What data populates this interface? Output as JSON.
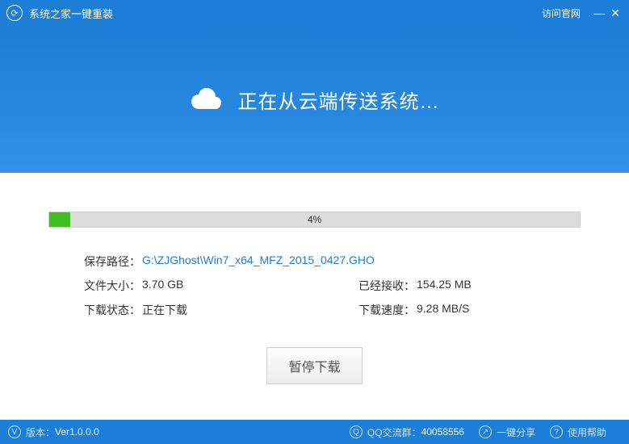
{
  "titlebar": {
    "title": "系统之家一键重装",
    "official_link": "访问官网"
  },
  "hero": {
    "text": "正在从云端传送系统…"
  },
  "progress": {
    "percent": 4,
    "percent_label": "4%"
  },
  "info": {
    "save_path_label": "保存路径：",
    "save_path_value": "G:\\ZJGhost\\Win7_x64_MFZ_2015_0427.GHO",
    "file_size_label": "文件大小：",
    "file_size_value": "3.70 GB",
    "received_label": "已经接收：",
    "received_value": "154.25 MB",
    "status_label": "下载状态：",
    "status_value": "正在下载",
    "speed_label": "下载速度：",
    "speed_value": "9.28 MB/S"
  },
  "buttons": {
    "pause": "暂停下载"
  },
  "footer": {
    "version_label": "版本：",
    "version_value": "Ver1.0.0.0",
    "qq_label": "QQ交流群：",
    "qq_value": "40058556",
    "share": "一键分享",
    "help": "使用帮助"
  },
  "colors": {
    "primary": "#1c7ed6",
    "progress_fill": "#3fbf1f"
  }
}
